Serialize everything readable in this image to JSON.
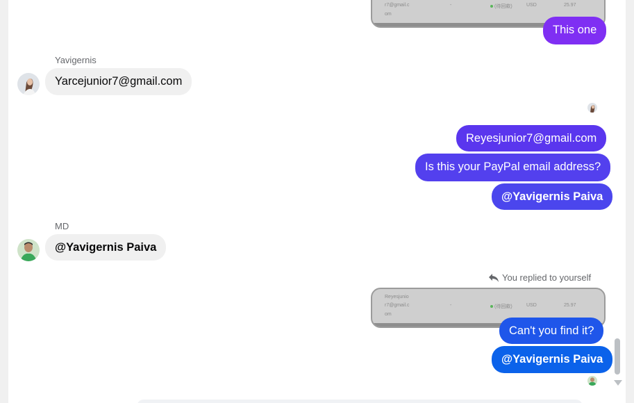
{
  "colors": {
    "bubble_purple": "#7f2ff3",
    "bubble_violet": "#5a36ee",
    "bubble_blue": "#0b62ea",
    "incoming_bg": "#f0f0f0"
  },
  "messages": {
    "m1": {
      "text": "This one"
    },
    "m2": {
      "sender": "Yavigernis",
      "text": "Yarcejunior7@gmail.com"
    },
    "m3": {
      "text": "Reyesjunior7@gmail.com"
    },
    "m4": {
      "text": "Is this your PayPal email address?"
    },
    "m5": {
      "text": "@Yavigernis Paiva"
    },
    "m6": {
      "sender": "MD",
      "text": "@Yavigernis Paiva"
    },
    "reply_note": {
      "text": "You replied to yourself"
    },
    "m7": {
      "text": "Can't you find it?"
    },
    "m8": {
      "text": "@Yavigernis Paiva"
    }
  },
  "screenshot": {
    "col1_a": "r7@gmail.c",
    "col1_b": "om",
    "col1_top": "Reyesjunio",
    "dash": "-",
    "status": "(待回款)",
    "currency": "USD",
    "amount": "25.97"
  },
  "icons": {
    "reply": "reply-arrow-icon",
    "scroll_down": "chevron-down-icon"
  }
}
